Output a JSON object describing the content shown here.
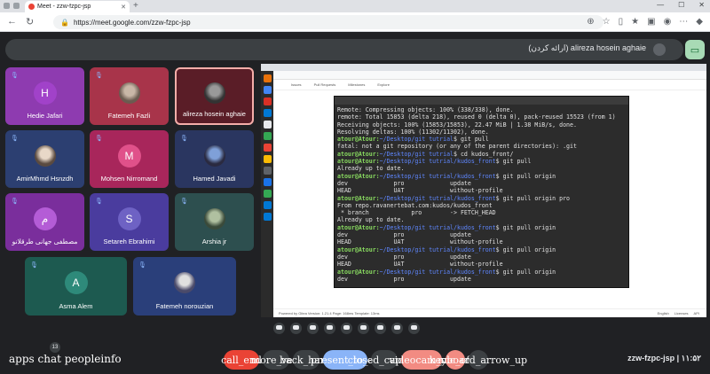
{
  "browser": {
    "tab_title": "Meet - zzw-fzpc-jsp",
    "url": "https://meet.google.com/zzw-fzpc-jsp"
  },
  "meet": {
    "presenter_label": "(ارائه کردن) alireza hosein aghaie",
    "meeting_code": "zzw-fzpc-jsp",
    "time": "۱۱:۵۲",
    "people_count": "13"
  },
  "participants": [
    {
      "name": "Hedie Jafari",
      "letter": "H"
    },
    {
      "name": "Fatemeh Fazli",
      "letter": ""
    },
    {
      "name": "alireza hosein aghaie",
      "letter": ""
    },
    {
      "name": "AmirMhmd Hsnzdh",
      "letter": ""
    },
    {
      "name": "Mohsen Nirromand",
      "letter": "M"
    },
    {
      "name": "Hamed Javadi",
      "letter": ""
    },
    {
      "name": "مصطفی جهانی طرقلانو",
      "letter": "م"
    },
    {
      "name": "Setareh Ebrahimi",
      "letter": "S"
    },
    {
      "name": "Arshia jr",
      "letter": ""
    },
    {
      "name": "Asma Alem",
      "letter": "A"
    },
    {
      "name": "Fatemeh norouzian",
      "letter": ""
    }
  ],
  "terminal": {
    "lines": [
      {
        "t": "plain",
        "text": "Remote: Compressing objects: 100% (338/338), done."
      },
      {
        "t": "plain",
        "text": "remote: Total 15853 (delta 218), reused 0 (delta 0), pack-reused 15523 (from 1)"
      },
      {
        "t": "plain",
        "text": "Receiving objects: 100% (15853/15853), 22.47 MiB | 1.38 MiB/s, done."
      },
      {
        "t": "plain",
        "text": "Resolving deltas: 100% (11302/11302), done."
      },
      {
        "t": "prompt",
        "path": "~/Desktop/git tutrial",
        "cmd": "$ git pull"
      },
      {
        "t": "plain",
        "text": "fatal: not a git repository (or any of the parent directories): .git"
      },
      {
        "t": "prompt",
        "path": "~/Desktop/git tutrial",
        "cmd": "$ cd kudos_front/"
      },
      {
        "t": "prompt",
        "path": "~/Desktop/git tutrial/kudos_front",
        "cmd": "$ git pull"
      },
      {
        "t": "plain",
        "text": "Already up to date."
      },
      {
        "t": "prompt",
        "path": "~/Desktop/git tutrial/kudos_front",
        "cmd": "$ git pull origin"
      },
      {
        "t": "plain",
        "text": "dev             pro             update"
      },
      {
        "t": "plain",
        "text": "HEAD            UAT             without-profile"
      },
      {
        "t": "prompt",
        "path": "~/Desktop/git tutrial/kudos_front",
        "cmd": "$ git pull origin pro"
      },
      {
        "t": "plain",
        "text": "From repo.ravanertebat.com:kudos/kudos_front"
      },
      {
        "t": "plain",
        "text": " * branch            pro        -> FETCH_HEAD"
      },
      {
        "t": "plain",
        "text": "Already up to date."
      },
      {
        "t": "prompt",
        "path": "~/Desktop/git tutrial/kudos_front",
        "cmd": "$ git pull origin"
      },
      {
        "t": "plain",
        "text": "dev             pro             update"
      },
      {
        "t": "plain",
        "text": "HEAD            UAT             without-profile"
      },
      {
        "t": "prompt",
        "path": "~/Desktop/git tutrial/kudos_front",
        "cmd": "$ git pull origin"
      },
      {
        "t": "plain",
        "text": "dev             pro             update"
      },
      {
        "t": "plain",
        "text": "HEAD            UAT             without-profile"
      },
      {
        "t": "prompt",
        "path": "~/Desktop/git tutrial/kudos_front",
        "cmd": "$ git pull origin"
      },
      {
        "t": "plain",
        "text": "dev             pro             update"
      }
    ],
    "user": "atour@Atour"
  },
  "shared_screen": {
    "nav_items": [
      "Issues",
      "Pull Requests",
      "Milestones",
      "Explore"
    ],
    "footer_text": "Powered by Gitea  Version: 1.21.4 Page: 168ms Template: 13ms",
    "footer_right": [
      "English",
      "Licenses",
      "API"
    ]
  },
  "controls": {
    "left_labels": [
      "apps",
      "chat",
      "people",
      "info"
    ],
    "center_labels": [
      {
        "label": "call_end",
        "color": "#ea4335"
      },
      {
        "label": "more_vert",
        "color": "#3c4043"
      },
      {
        "label": "back_hand",
        "color": "#3c4043"
      },
      {
        "label": "present_to_all",
        "color": "#8ab4f8"
      },
      {
        "label": "closed_caption",
        "color": "#3c4043"
      },
      {
        "label": "videocam_off",
        "color": "#f28b82"
      },
      {
        "label": "mic_off",
        "color": "#f28b82"
      },
      {
        "label": "keyboard_arrow_up",
        "color": "#3c4043"
      }
    ]
  },
  "colors": {
    "background": "#202124",
    "present_button": "#a8dab5"
  }
}
